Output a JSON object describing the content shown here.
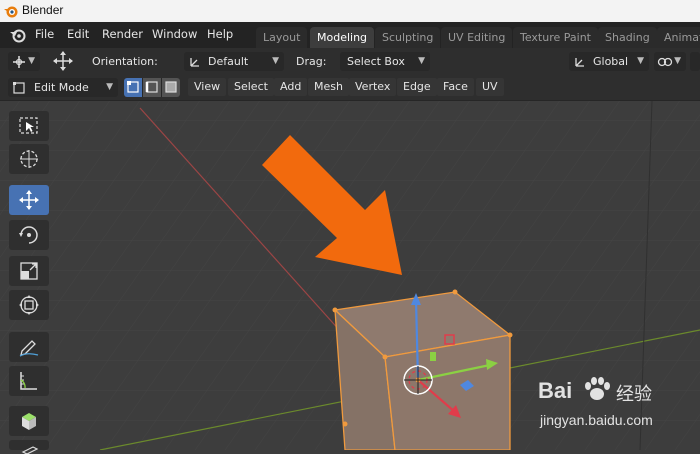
{
  "window": {
    "title": "Blender"
  },
  "menubar": {
    "items": [
      "File",
      "Edit",
      "Render",
      "Window",
      "Help"
    ]
  },
  "workspace_tabs": [
    {
      "label": "Layout",
      "active": false
    },
    {
      "label": "Modeling",
      "active": true
    },
    {
      "label": "Sculpting",
      "active": false
    },
    {
      "label": "UV Editing",
      "active": false
    },
    {
      "label": "Texture Paint",
      "active": false
    },
    {
      "label": "Shading",
      "active": false
    },
    {
      "label": "Animati",
      "active": false
    }
  ],
  "tool_header": {
    "orientation_label": "Orientation:",
    "orientation_value": "Default",
    "drag_label": "Drag:",
    "drag_value": "Select Box",
    "transform_orientation": "Global"
  },
  "mode_header": {
    "mode": "Edit Mode",
    "menus": [
      "View",
      "Select",
      "Add",
      "Mesh",
      "Vertex",
      "Edge",
      "Face",
      "UV"
    ]
  },
  "toolbar_tools": [
    "select-box",
    "cursor",
    "move",
    "rotate",
    "scale",
    "transform",
    "annotate",
    "measure",
    "add-cube",
    "extrude"
  ],
  "watermark": {
    "brand": "Bai",
    "brand_suffix": "经验",
    "url": "jingyan.baidu.com"
  },
  "colors": {
    "accent": "#4772b3",
    "arrow": "#f26a0d",
    "selection": "#f09a3e"
  }
}
